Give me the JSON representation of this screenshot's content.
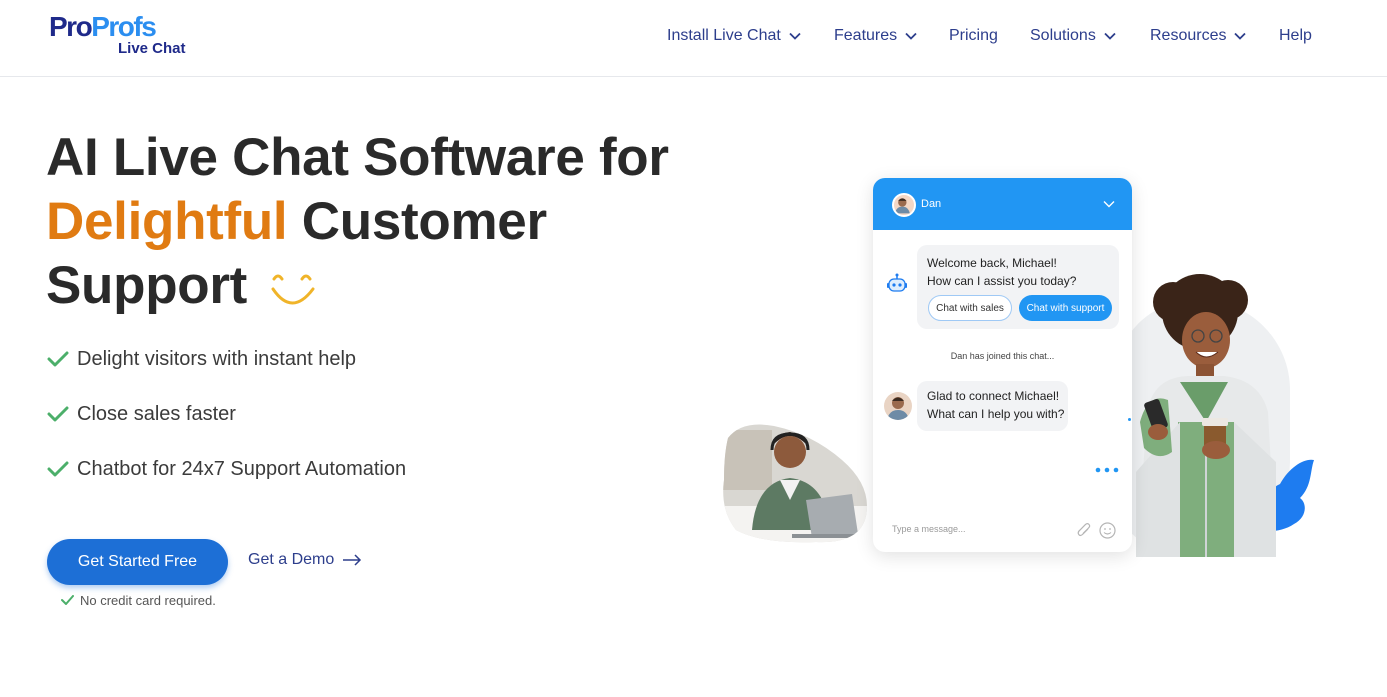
{
  "brand": {
    "logo_pro": "Pro",
    "logo_profs": "Profs",
    "logo_sub": "Live Chat",
    "colors": {
      "navy": "#1f2a8a",
      "blue": "#2b8ef0",
      "accent": "#e07b12",
      "cta": "#1d6fd6",
      "check": "#4caf6a"
    }
  },
  "nav": {
    "items": [
      {
        "label": "Install Live Chat",
        "has_dropdown": true,
        "icon": "chevron-down-icon"
      },
      {
        "label": "Features",
        "has_dropdown": true,
        "icon": "chevron-down-icon"
      },
      {
        "label": "Pricing",
        "has_dropdown": false
      },
      {
        "label": "Solutions",
        "has_dropdown": true,
        "icon": "chevron-down-icon"
      },
      {
        "label": "Resources",
        "has_dropdown": true,
        "icon": "chevron-down-icon"
      },
      {
        "label": "Help",
        "has_dropdown": false
      }
    ]
  },
  "hero": {
    "title_part1": "AI Live Chat Software for",
    "title_accent": "Delightful",
    "title_part2": "Customer Support",
    "title_icon": "smile-icon",
    "bullets": [
      "Delight visitors with instant help",
      "Close sales faster",
      "Chatbot for 24x7 Support Automation"
    ],
    "cta_primary": "Get Started Free",
    "cta_secondary": "Get a Demo",
    "note": "No credit card required."
  },
  "chat_widget": {
    "agent_name": "Dan",
    "bot_message_line1": "Welcome back, Michael!",
    "bot_message_line2": "How can I assist you today?",
    "option_sales": "Chat with sales",
    "option_support": "Chat with support",
    "system_message": "Dan has joined this chat...",
    "agent_message_line1": "Glad to connect Michael!",
    "agent_message_line2": "What can I help you with?",
    "input_placeholder": "Type a message...",
    "header_color": "#2196f3"
  }
}
